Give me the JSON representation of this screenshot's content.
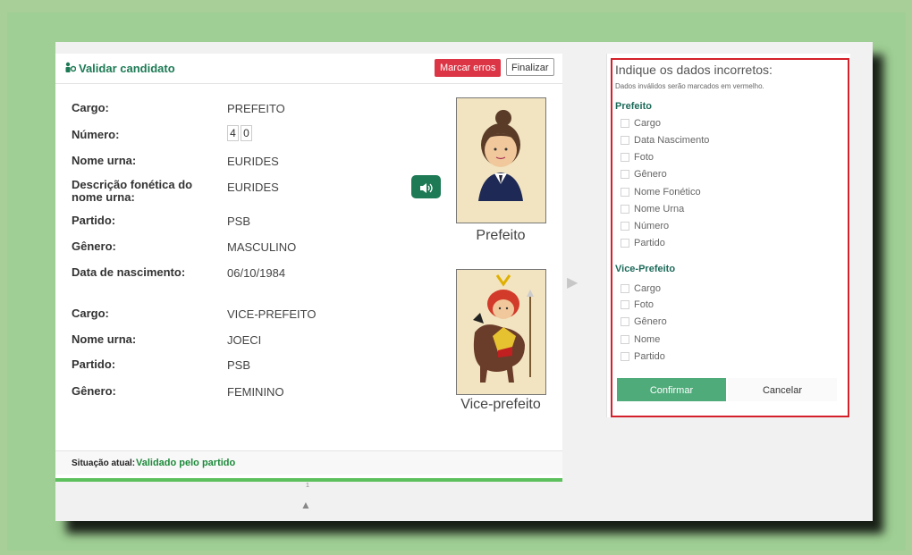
{
  "card": {
    "title": "Validar candidato",
    "mark_errors_label": "Marcar erros",
    "finish_label": "Finalizar"
  },
  "prefeito": {
    "cargo_label": "Cargo:",
    "cargo": "PREFEITO",
    "numero_label": "Número:",
    "numero": [
      "4",
      "0"
    ],
    "nome_urna_label": "Nome urna:",
    "nome_urna": "EURIDES",
    "fonetica_label": "Descrição fonética do nome urna:",
    "fonetica": "EURIDES",
    "partido_label": "Partido:",
    "partido": "PSB",
    "genero_label": "Gênero:",
    "genero": "MASCULINO",
    "nascimento_label": "Data de nascimento:",
    "nascimento": "06/10/1984",
    "photo_caption": "Prefeito"
  },
  "vice": {
    "cargo_label": "Cargo:",
    "cargo": "VICE-PREFEITO",
    "nome_urna_label": "Nome urna:",
    "nome_urna": "JOECI",
    "partido_label": "Partido:",
    "partido": "PSB",
    "genero_label": "Gênero:",
    "genero": "FEMININO",
    "photo_caption": "Vice-prefeito"
  },
  "footer": {
    "label": "Situação atual:",
    "value": "Validado pelo partido"
  },
  "pagination": {
    "page": "1"
  },
  "panel": {
    "title": "Indique os dados incorretos:",
    "subtitle": "Dados inválidos serão marcados em vermelho.",
    "group1": {
      "title": "Prefeito",
      "items": [
        "Cargo",
        "Data Nascimento",
        "Foto",
        "Gênero",
        "Nome Fonético",
        "Nome Urna",
        "Número",
        "Partido"
      ]
    },
    "group2": {
      "title": "Vice-Prefeito",
      "items": [
        "Cargo",
        "Foto",
        "Gênero",
        "Nome",
        "Partido"
      ]
    },
    "confirm_label": "Confirmar",
    "cancel_label": "Cancelar"
  },
  "colors": {
    "primary_green": "#1d7a55",
    "danger_red": "#dc3545",
    "confirm_green": "#4fab7a",
    "status_green": "#1d8a3a"
  }
}
